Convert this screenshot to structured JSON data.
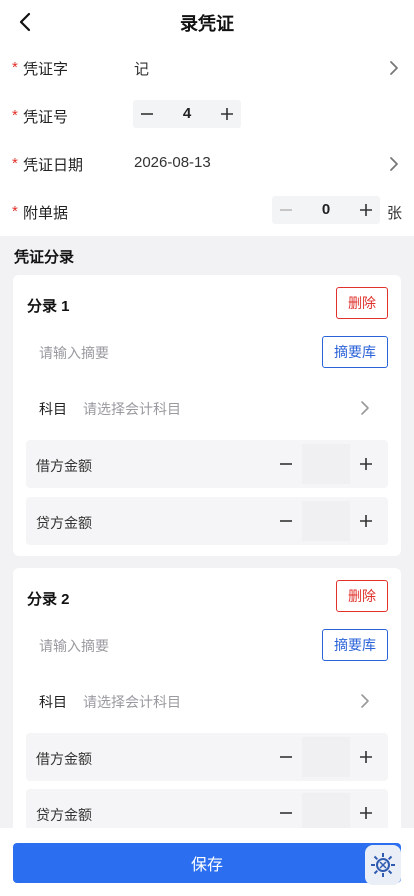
{
  "header": {
    "title": "录凭证"
  },
  "form": {
    "required_mark": "*",
    "word": {
      "label": "凭证字",
      "value": "记"
    },
    "number": {
      "label": "凭证号",
      "value": "4"
    },
    "date": {
      "label": "凭证日期",
      "value": "2026-08-13"
    },
    "attachments": {
      "label": "附单据",
      "value": "0",
      "unit": "张"
    }
  },
  "entries": {
    "section_title": "凭证分录",
    "items": [
      {
        "title": "分录 1",
        "delete_label": "删除",
        "summary_placeholder": "请输入摘要",
        "library_label": "摘要库",
        "subject_label": "科目",
        "subject_placeholder": "请选择会计科目",
        "debit_label": "借方金额",
        "credit_label": "贷方金额"
      },
      {
        "title": "分录 2",
        "delete_label": "删除",
        "summary_placeholder": "请输入摘要",
        "library_label": "摘要库",
        "subject_label": "科目",
        "subject_placeholder": "请选择会计科目",
        "debit_label": "借方金额",
        "credit_label": "贷方金额"
      }
    ]
  },
  "footer": {
    "save_label": "保存"
  },
  "icons": {
    "back": "chevron-left-icon",
    "chevron": "chevron-right-icon",
    "minus": "minus-icon",
    "plus": "plus-icon",
    "fab": "gear-icon"
  },
  "colors": {
    "primary": "#2b6ff0",
    "danger": "#e0312b",
    "link": "#2b63d8"
  }
}
